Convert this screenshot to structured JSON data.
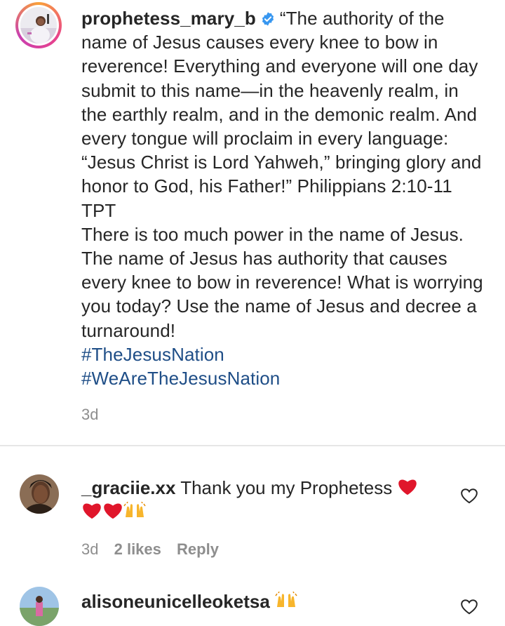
{
  "post": {
    "username": "prophetess_mary_b",
    "caption_lines": [
      "“The authority of the name of Jesus causes every knee to bow in reverence! Everything and everyone will one day submit to this name—in the heavenly realm, in the earthly realm, and in the demonic realm. And every tongue will proclaim in every language: “Jesus Christ is Lord Yahweh,” bringing glory and honor to God, his Father!” Philippians 2:10-11 TPT",
      "There is too much power in the name of Jesus. The name of Jesus has authority that causes every knee to bow in reverence! What is worrying you today? Use the name of Jesus and decree a turnaround!"
    ],
    "hashtags": [
      "#TheJesusNation",
      "#WeAreTheJesusNation"
    ],
    "timestamp": "3d"
  },
  "comments": [
    {
      "username": "_graciie.xx",
      "text": "Thank you my Prophetess",
      "time": "3d",
      "likes": "2 likes",
      "reply": "Reply"
    },
    {
      "username": "alisoneunicelleoketsa",
      "text": ""
    }
  ],
  "icons": {
    "verified": "verified-badge-icon",
    "like": "heart-outline-icon",
    "emoji_heart": "red-heart-emoji",
    "emoji_hands": "raising-hands-emoji"
  },
  "colors": {
    "hashtag": "#1f4e87",
    "verified": "#3897f0",
    "secondary_text": "#8e8e8e",
    "heart": "#e0162b"
  }
}
